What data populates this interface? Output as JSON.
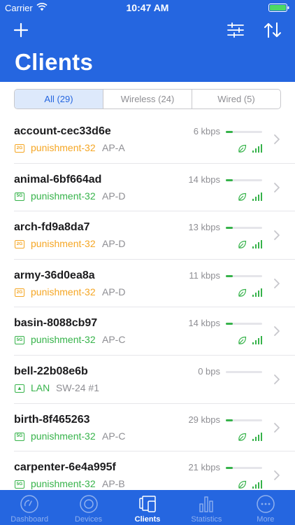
{
  "status_bar": {
    "carrier": "Carrier",
    "time": "10:47 AM"
  },
  "header": {
    "title": "Clients"
  },
  "filter": {
    "segments": [
      {
        "label": "All (29)",
        "active": true
      },
      {
        "label": "Wireless (24)",
        "active": false
      },
      {
        "label": "Wired (5)",
        "active": false
      }
    ]
  },
  "clients": [
    {
      "name": "account-cec33d6e",
      "band": "2G",
      "network": "punishment-32",
      "ap": "AP-A",
      "rate": "6 kbps",
      "usage": 0.2,
      "wireless": true
    },
    {
      "name": "animal-6bf664ad",
      "band": "5G",
      "network": "punishment-32",
      "ap": "AP-D",
      "rate": "14 kbps",
      "usage": 0.2,
      "wireless": true
    },
    {
      "name": "arch-fd9a8da7",
      "band": "2G",
      "network": "punishment-32",
      "ap": "AP-D",
      "rate": "13 kbps",
      "usage": 0.2,
      "wireless": true
    },
    {
      "name": "army-36d0ea8a",
      "band": "2G",
      "network": "punishment-32",
      "ap": "AP-D",
      "rate": "11 kbps",
      "usage": 0.2,
      "wireless": true
    },
    {
      "name": "basin-8088cb97",
      "band": "5G",
      "network": "punishment-32",
      "ap": "AP-C",
      "rate": "14 kbps",
      "usage": 0.2,
      "wireless": true
    },
    {
      "name": "bell-22b08e6b",
      "band": "LAN",
      "network": "LAN",
      "ap": "SW-24 #1",
      "rate": "0 bps",
      "usage": 0,
      "wireless": false
    },
    {
      "name": "birth-8f465263",
      "band": "5G",
      "network": "punishment-32",
      "ap": "AP-C",
      "rate": "29 kbps",
      "usage": 0.2,
      "wireless": true
    },
    {
      "name": "carpenter-6e4a995f",
      "band": "5G",
      "network": "punishment-32",
      "ap": "AP-B",
      "rate": "21 kbps",
      "usage": 0.2,
      "wireless": true
    }
  ],
  "tabs": [
    {
      "label": "Dashboard",
      "icon": "dashboard-icon",
      "active": false
    },
    {
      "label": "Devices",
      "icon": "devices-icon",
      "active": false
    },
    {
      "label": "Clients",
      "icon": "clients-icon",
      "active": true
    },
    {
      "label": "Statistics",
      "icon": "statistics-icon",
      "active": false
    },
    {
      "label": "More",
      "icon": "more-icon",
      "active": false
    }
  ],
  "colors": {
    "brand": "#2566e0",
    "band_2g": "#f5a623",
    "band_5g": "#36b34a"
  }
}
